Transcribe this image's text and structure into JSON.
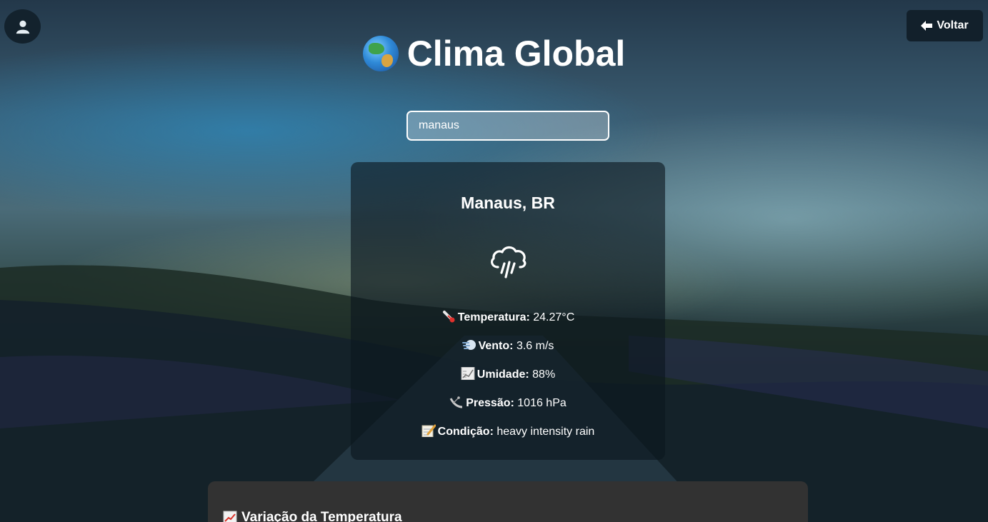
{
  "header": {
    "title": "Clima Global",
    "back_label": "Voltar"
  },
  "search": {
    "value": "manaus"
  },
  "weather": {
    "city": "Manaus, BR",
    "icon": "cloud-rain-icon",
    "rows": [
      {
        "icon": "thermometer-icon",
        "label": "Temperatura:",
        "value": "24.27°C"
      },
      {
        "icon": "wind-icon",
        "label": "Vento:",
        "value": "3.6 m/s"
      },
      {
        "icon": "humidity-icon",
        "label": "Umidade:",
        "value": "88%"
      },
      {
        "icon": "satellite-icon",
        "label": "Pressão:",
        "value": "1016 hPa"
      },
      {
        "icon": "memo-icon",
        "label": "Condição:",
        "value": "heavy intensity rain"
      }
    ]
  },
  "chart_panel": {
    "title": "Variação da Temperatura"
  },
  "colors": {
    "card_bg": "#0c161e",
    "button_bg": "#12202b",
    "panel_bg": "#323232"
  }
}
